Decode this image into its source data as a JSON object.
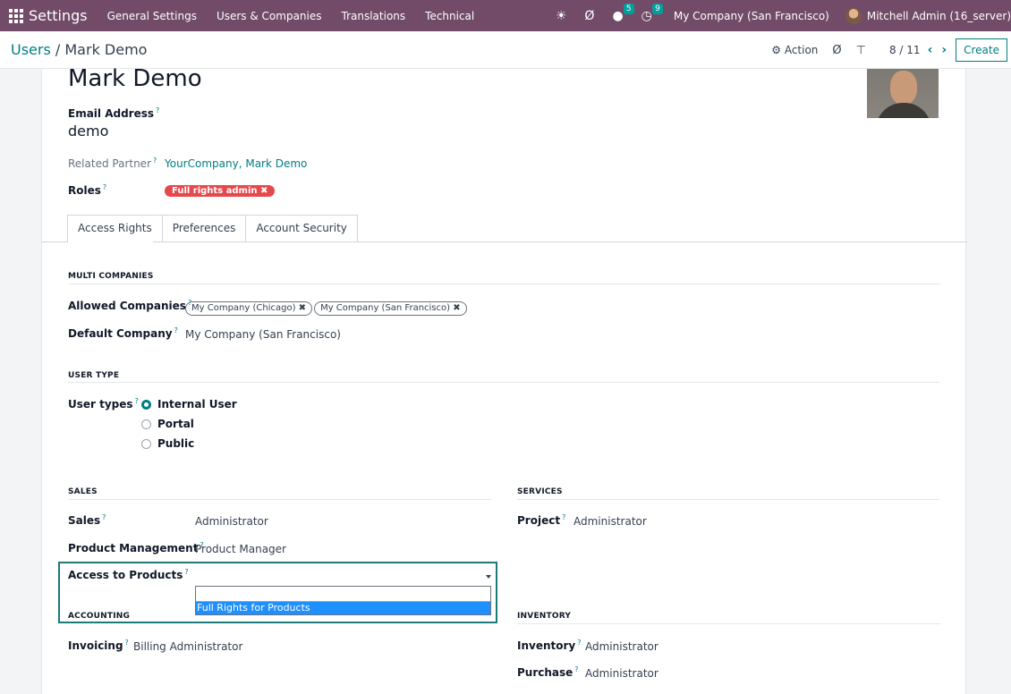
{
  "navbar": {
    "app_name": "Settings",
    "menus": [
      "General Settings",
      "Users & Companies",
      "Translations",
      "Technical"
    ],
    "icons": {
      "debug": "bug-icon",
      "activity": "refresh-icon",
      "messages": "chat-icon",
      "activities": "clock-icon"
    },
    "messages_count": "5",
    "activities_count": "9",
    "company": "My Company (San Francisco)",
    "user": "Mitchell Admin (16_server)"
  },
  "control_panel": {
    "breadcrumb_parent": "Users",
    "breadcrumb_sep": " / ",
    "breadcrumb_current": "Mark Demo",
    "action_label": "Action",
    "pager": "8 / 11",
    "create_label": "Create"
  },
  "form": {
    "name": "Mark Demo",
    "email_label": "Email Address",
    "email_value": "demo",
    "related_partner_label": "Related Partner",
    "related_partner_value": "YourCompany, Mark Demo",
    "roles_label": "Roles",
    "roles_tag": "Full rights admin",
    "tabs": [
      "Access Rights",
      "Preferences",
      "Account Security"
    ],
    "active_tab": "Access Rights"
  },
  "multi_companies": {
    "section": "MULTI COMPANIES",
    "allowed_label": "Allowed Companies",
    "allowed_tags": [
      "My Company (Chicago)",
      "My Company (San Francisco)"
    ],
    "default_label": "Default Company",
    "default_value": "My Company (San Francisco)"
  },
  "user_type": {
    "section": "USER TYPE",
    "label": "User types",
    "options": [
      "Internal User",
      "Portal",
      "Public"
    ],
    "selected": "Internal User"
  },
  "sales": {
    "section": "SALES",
    "sales_label": "Sales",
    "sales_value": "Administrator",
    "product_mgmt_label": "Product Management",
    "product_mgmt_value": "Product Manager",
    "access_products_label": "Access to Products",
    "dropdown_option": "Full Rights for Products"
  },
  "services": {
    "section": "SERVICES",
    "project_label": "Project",
    "project_value": "Administrator"
  },
  "accounting": {
    "section": "ACCOUNTING",
    "invoicing_label": "Invoicing",
    "invoicing_value": "Billing Administrator"
  },
  "inventory": {
    "section": "INVENTORY",
    "inventory_label": "Inventory",
    "inventory_value": "Administrator",
    "purchase_label": "Purchase",
    "purchase_value": "Administrator"
  },
  "help_mark": "?",
  "remove_glyph": "✖",
  "colors": {
    "brand": "#714b67",
    "accent": "#017e84",
    "tag_red": "#e5484d",
    "highlight": "#1e90ff"
  }
}
